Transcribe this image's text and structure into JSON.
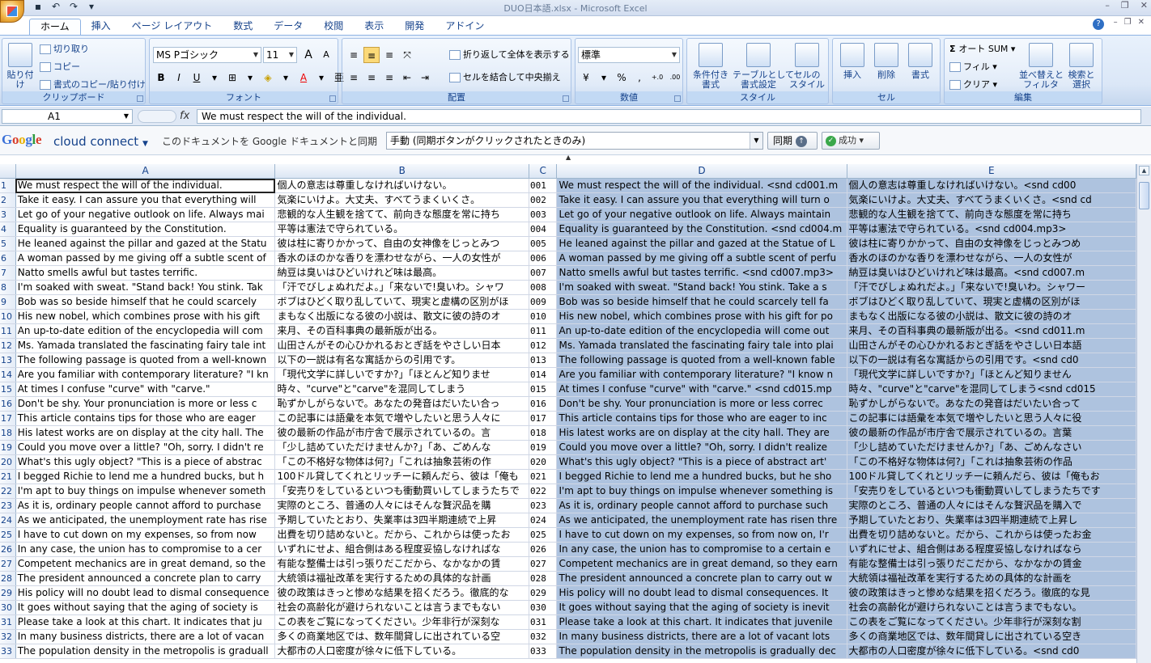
{
  "window": {
    "title": "DUO日本語.xlsx - Microsoft Excel"
  },
  "tabs": [
    "ホーム",
    "挿入",
    "ページ レイアウト",
    "数式",
    "データ",
    "校閲",
    "表示",
    "開発",
    "アドイン"
  ],
  "ribbon": {
    "clipboard": {
      "paste": "貼り付け",
      "cut": "切り取り",
      "copy": "コピー",
      "format_painter": "書式のコピー/貼り付け",
      "label": "クリップボード"
    },
    "font": {
      "name": "MS Pゴシック",
      "size": "11",
      "label": "フォント",
      "bold": "B",
      "italic": "I",
      "underline": "U",
      "grow": "A",
      "shrink": "A"
    },
    "alignment": {
      "wrap": "折り返して全体を表示する",
      "merge": "セルを結合して中央揃え",
      "label": "配置"
    },
    "number": {
      "format": "標準",
      "percent": "%",
      "comma": ",",
      "inc": ".0 .00",
      "dec": ".00 .0",
      "label": "数値"
    },
    "styles": {
      "conditional": "条件付き\n書式",
      "table": "テーブルとして\n書式設定",
      "cell": "セルの\nスタイル",
      "label": "スタイル"
    },
    "cells": {
      "insert": "挿入",
      "delete": "削除",
      "format": "書式",
      "label": "セル"
    },
    "editing": {
      "autosum": "オート SUM",
      "fill": "フィル",
      "clear": "クリア",
      "sort": "並べ替えと\nフィルタ",
      "find": "検索と\n選択",
      "label": "編集"
    }
  },
  "formula_bar": {
    "name_box": "A1",
    "fx": "fx",
    "content": "We must respect the will of the individual."
  },
  "google_bar": {
    "logo": "Google",
    "product": "cloud connect",
    "sync_with": "このドキュメントを Google ドキュメントと同期",
    "mode": "手動 (同期ボタンがクリックされたときのみ)",
    "sync_button": "同期",
    "status": "成功"
  },
  "columns": [
    "A",
    "B",
    "C",
    "D",
    "E"
  ],
  "rows": [
    {
      "n": "1",
      "a": "We must respect the will of the individual.",
      "b": "個人の意志は尊重しなければいけない。",
      "c": "001",
      "d": "We must respect the will of the individual. <snd cd001.m",
      "e": "個人の意志は尊重しなければいけない。<snd cd00"
    },
    {
      "n": "2",
      "a": "Take it easy. I can assure you that everything will",
      "b": "気楽にいけよ。大丈夫、すべてうまくいくさ。",
      "c": "002",
      "d": "Take it easy. I can assure you that everything will turn o",
      "e": "気楽にいけよ。大丈夫、すべてうまくいくさ。<snd cd"
    },
    {
      "n": "3",
      "a": "Let go of your negative outlook on life. Always mai",
      "b": "悲観的な人生観を捨てて、前向きな態度を常に持ち",
      "c": "003",
      "d": "Let go of your negative outlook on life. Always maintain",
      "e": "悲観的な人生観を捨てて、前向きな態度を常に持ち"
    },
    {
      "n": "4",
      "a": "Equality is guaranteed by the Constitution.",
      "b": "平等は憲法で守られている。",
      "c": "004",
      "d": "Equality is guaranteed by the Constitution. <snd cd004.m",
      "e": "平等は憲法で守られている。<snd cd004.mp3>"
    },
    {
      "n": "5",
      "a": "He leaned against the pillar and gazed at the Statu",
      "b": "彼は柱に寄りかかって、自由の女神像をじっとみつ",
      "c": "005",
      "d": "He leaned against the pillar and gazed at the Statue of L",
      "e": "彼は柱に寄りかかって、自由の女神像をじっとみつめ"
    },
    {
      "n": "6",
      "a": "A woman passed by me giving off a subtle scent of",
      "b": "香水のほのかな香りを漂わせながら、一人の女性が",
      "c": "006",
      "d": "A woman passed by me giving off a subtle scent of perfu",
      "e": "香水のほのかな香りを漂わせながら、一人の女性が"
    },
    {
      "n": "7",
      "a": "Natto smells awful but tastes terrific.",
      "b": "納豆は臭いはひどいけれど味は最高。",
      "c": "007",
      "d": "Natto smells awful but tastes terrific. <snd cd007.mp3>",
      "e": "納豆は臭いはひどいけれど味は最高。<snd cd007.m"
    },
    {
      "n": "8",
      "a": "I'm soaked with sweat. \"Stand back! You stink. Tak",
      "b": "「汗でびしょぬれだよ。」「来ないで!臭いわ。シャワ",
      "c": "008",
      "d": "I'm soaked with sweat. \"Stand back! You stink. Take a s",
      "e": "「汗でびしょぬれだよ。」「来ないで!臭いわ。シャワー"
    },
    {
      "n": "9",
      "a": "Bob was so beside himself that he could scarcely",
      "b": "ボブはひどく取り乱していて、現実と虚構の区別がほ",
      "c": "009",
      "d": "Bob was so beside himself that he could scarcely tell fa",
      "e": "ボブはひどく取り乱していて、現実と虚構の区別がほ"
    },
    {
      "n": "10",
      "a": "His new nobel, which combines prose with his gift",
      "b": "まもなく出版になる彼の小説は、散文に彼の詩のオ",
      "c": "010",
      "d": "His new nobel, which combines prose with his gift for po",
      "e": "まもなく出版になる彼の小説は、散文に彼の詩のオ"
    },
    {
      "n": "11",
      "a": "An up-to-date edition of the encyclopedia will com",
      "b": "来月、その百科事典の最新版が出る。",
      "c": "011",
      "d": "An up-to-date edition of the encyclopedia will come out",
      "e": "来月、その百科事典の最新版が出る。<snd cd011.m"
    },
    {
      "n": "12",
      "a": "Ms. Yamada translated the fascinating fairy tale int",
      "b": "山田さんがその心ひかれるおとぎ話をやさしい日本",
      "c": "012",
      "d": "Ms. Yamada translated the fascinating fairy tale into plai",
      "e": "山田さんがその心ひかれるおとぎ話をやさしい日本語"
    },
    {
      "n": "13",
      "a": "The following passage is quoted from a well-known",
      "b": "以下の一説は有名な寓話からの引用です。",
      "c": "013",
      "d": "The following passage is quoted from a well-known fable",
      "e": "以下の一説は有名な寓話からの引用です。<snd cd0"
    },
    {
      "n": "14",
      "a": "Are you familiar with contemporary literature? \"I kn",
      "b": "「現代文学に詳しいですか?」「ほとんど知りませ",
      "c": "014",
      "d": "Are you familiar with contemporary literature? \"I know n",
      "e": "「現代文学に詳しいですか?」「ほとんど知りません"
    },
    {
      "n": "15",
      "a": "At times I confuse \"curve\" with \"carve.\"",
      "b": "時々、\"curve\"と\"carve\"を混同してしまう",
      "c": "015",
      "d": "At times I confuse \"curve\" with \"carve.\" <snd cd015.mp",
      "e": "時々、\"curve\"と\"carve\"を混同してしまう<snd cd015"
    },
    {
      "n": "16",
      "a": "Don't be shy. Your pronunciation is more or less c",
      "b": "恥ずかしがらないで。あなたの発音はだいたい合っ",
      "c": "016",
      "d": "Don't be shy. Your pronunciation is more or less correc",
      "e": "恥ずかしがらないで。あなたの発音はだいたい合って"
    },
    {
      "n": "17",
      "a": "This article contains tips for those who are eager",
      "b": "この記事には語彙を本気で増やしたいと思う人々に",
      "c": "017",
      "d": "This article contains tips for those who are eager to inc",
      "e": "この記事には語彙を本気で増やしたいと思う人々に役"
    },
    {
      "n": "18",
      "a": "His latest works are on display at the city hall. The",
      "b": "彼の最新の作品が市庁舎で展示されているの。言",
      "c": "018",
      "d": "His latest works are on display at the city hall. They are",
      "e": "彼の最新の作品が市庁舎で展示されているの。言葉"
    },
    {
      "n": "19",
      "a": "Could you move over a little? \"Oh, sorry. I didn't re",
      "b": "「少し詰めていただけませんか?」「あ、ごめんな",
      "c": "019",
      "d": "Could you move over a little? \"Oh, sorry. I didn't realize",
      "e": "「少し詰めていただけませんか?」「あ、ごめんなさい"
    },
    {
      "n": "20",
      "a": "What's this ugly object? \"This is a piece of abstrac",
      "b": "「この不格好な物体は何?」「これは抽象芸術の作",
      "c": "020",
      "d": "What's this ugly object? \"This is a piece of abstract art'",
      "e": "「この不格好な物体は何?」「これは抽象芸術の作品"
    },
    {
      "n": "21",
      "a": "I begged Richie to lend me a hundred bucks, but h",
      "b": "100ドル貸してくれとリッチーに頼んだら、彼は「俺も",
      "c": "021",
      "d": "I begged Richie to lend me a hundred bucks, but he sho",
      "e": "100ドル貸してくれとリッチーに頼んだら、彼は「俺もお"
    },
    {
      "n": "22",
      "a": "I'm apt to buy things on impulse whenever someth",
      "b": "「安売りをしているといつも衝動買いしてしまうたちで",
      "c": "022",
      "d": "I'm apt to buy things on impulse whenever something is",
      "e": "「安売りをしているといつも衝動買いしてしまうたちです"
    },
    {
      "n": "23",
      "a": "As it is, ordinary people cannot afford to purchase",
      "b": "実際のところ、普通の人々にはそんな贅沢品を購",
      "c": "023",
      "d": "As it is, ordinary people cannot afford to purchase such",
      "e": "実際のところ、普通の人々にはそんな贅沢品を購入で"
    },
    {
      "n": "24",
      "a": "As we anticipated, the unemployment rate has rise",
      "b": "予期していたとおり、失業率は3四半期連続で上昇",
      "c": "024",
      "d": "As we anticipated, the unemployment rate has risen thre",
      "e": "予期していたとおり、失業率は3四半期連続で上昇し"
    },
    {
      "n": "25",
      "a": "I have to cut down on my expenses, so from now",
      "b": "出費を切り詰めないと。だから、これからは使ったお",
      "c": "025",
      "d": "I have to cut down on my expenses, so from now on, I'r",
      "e": "出費を切り詰めないと。だから、これからは使ったお金"
    },
    {
      "n": "26",
      "a": "In any case, the union has to compromise to a cer",
      "b": "いずれにせよ、組合側はある程度妥協しなければな",
      "c": "026",
      "d": "In any case, the union has to compromise to a certain e",
      "e": "いずれにせよ、組合側はある程度妥協しなければなら"
    },
    {
      "n": "27",
      "a": "Competent mechanics are in great demand, so the",
      "b": "有能な整備士は引っ張りだこだから、なかなかの賃",
      "c": "027",
      "d": "Competent mechanics are in great demand, so they earn",
      "e": "有能な整備士は引っ張りだこだから、なかなかの賃金"
    },
    {
      "n": "28",
      "a": "The president announced a concrete plan to carry",
      "b": "大統領は福祉改革を実行するための具体的な計画",
      "c": "028",
      "d": "The president announced a concrete plan to carry out w",
      "e": "大統領は福祉改革を実行するための具体的な計画を"
    },
    {
      "n": "29",
      "a": "His policy will no doubt lead to dismal consequence",
      "b": "彼の政策はきっと惨めな結果を招くだろう。徹底的な",
      "c": "029",
      "d": "His policy will no doubt lead to dismal consequences. It",
      "e": "彼の政策はきっと惨めな結果を招くだろう。徹底的な見"
    },
    {
      "n": "30",
      "a": "It goes without saying that the aging of society is",
      "b": "社会の高齢化が避けられないことは言うまでもない",
      "c": "030",
      "d": "It goes without saying that the aging of society is inevit",
      "e": "社会の高齢化が避けられないことは言うまでもない。"
    },
    {
      "n": "31",
      "a": "Please take a look at this chart. It indicates that ju",
      "b": "この表をご覧になってください。少年非行が深刻な",
      "c": "031",
      "d": "Please take a look at this chart. It indicates that juvenile",
      "e": "この表をご覧になってください。少年非行が深刻な割"
    },
    {
      "n": "32",
      "a": "In many business districts, there are a lot of vacan",
      "b": "多くの商業地区では、数年間貸しに出されている空",
      "c": "032",
      "d": "In many business districts, there are a lot of vacant lots",
      "e": "多くの商業地区では、数年間貸しに出されている空き"
    },
    {
      "n": "33",
      "a": "The population density in the metropolis is graduall",
      "b": "大都市の人口密度が徐々に低下している。",
      "c": "033",
      "d": "The population density in the metropolis is gradually dec",
      "e": "大都市の人口密度が徐々に低下している。<snd cd0"
    }
  ]
}
